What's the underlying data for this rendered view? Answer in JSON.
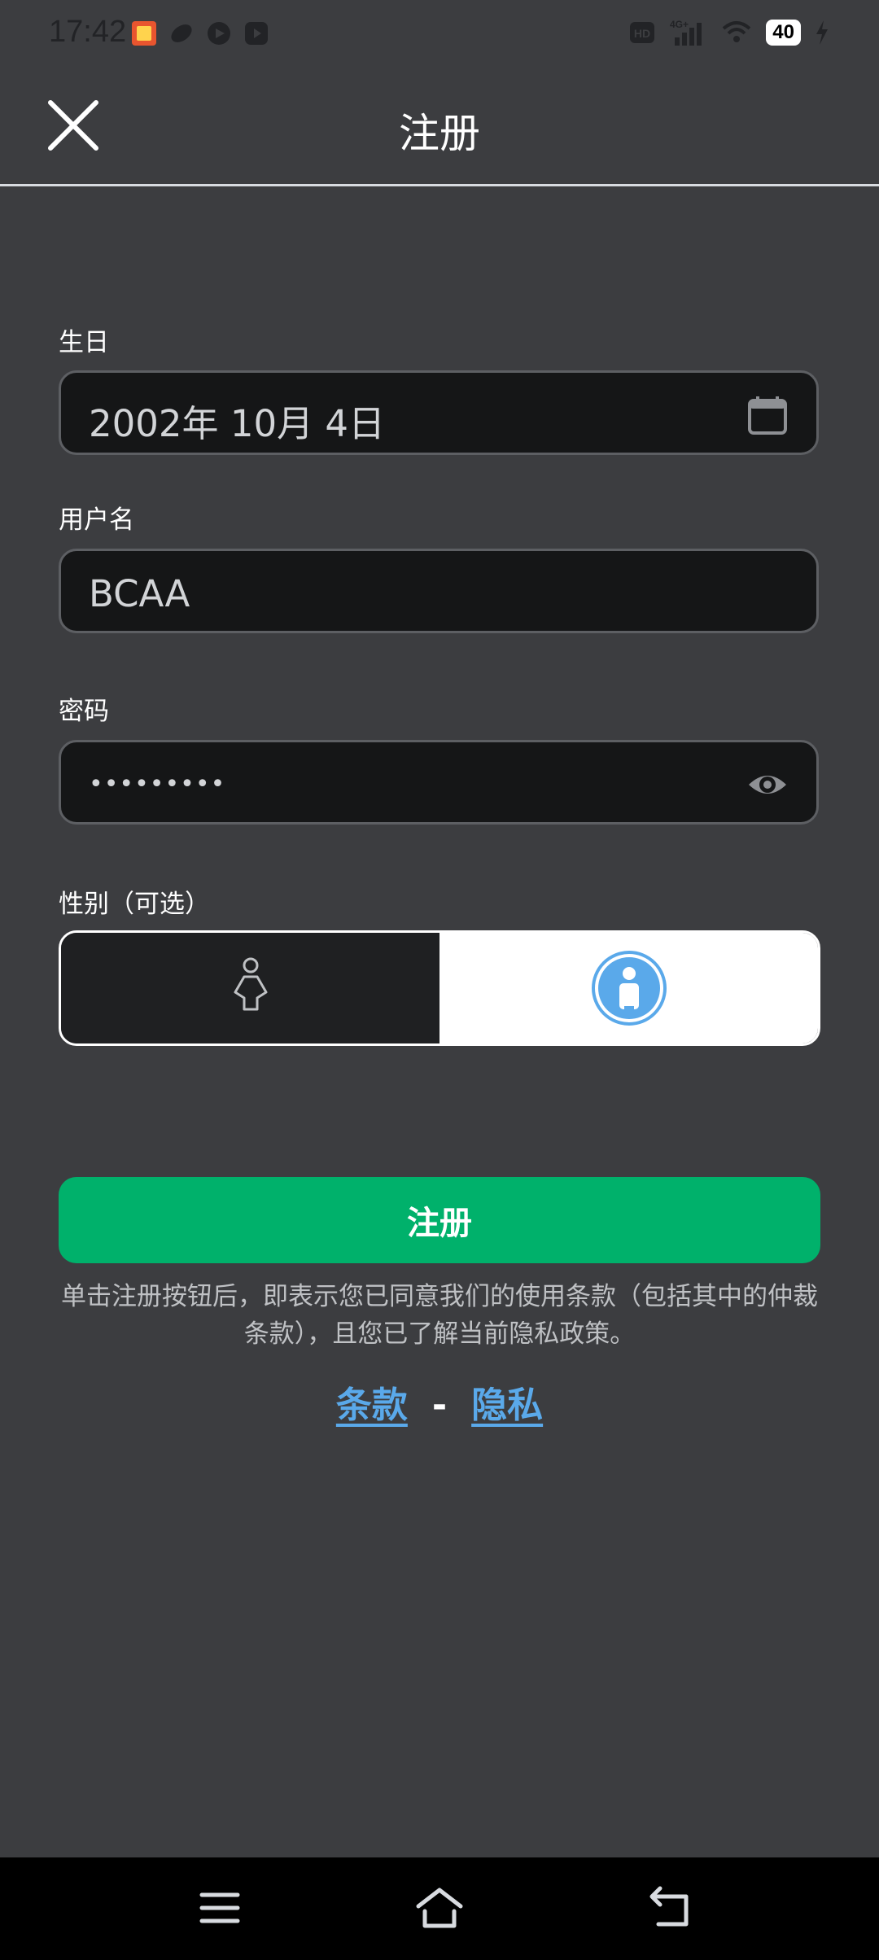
{
  "status_bar": {
    "time": "17:42",
    "network": "4G+",
    "battery": "40"
  },
  "header": {
    "title": "注册"
  },
  "form": {
    "birthday": {
      "label": "生日",
      "value": "2002年 10月 4日"
    },
    "username": {
      "label": "用户名",
      "value": "BCAA"
    },
    "password": {
      "label": "密码",
      "value": "•••••••••"
    },
    "gender": {
      "label": "性别（可选）",
      "selected": "male"
    }
  },
  "register_button": "注册",
  "legal": {
    "text": "单击注册按钮后，即表示您已同意我们的使用条款（包括其中的仲裁条款），且您已了解当前隐私政策。",
    "terms_link": "条款",
    "separator": "-",
    "privacy_link": "隐私"
  },
  "colors": {
    "background": "#3c3d40",
    "input_bg": "#151617",
    "accent_green": "#00b16b",
    "link_blue": "#5aa9ea",
    "gender_icon_blue": "#5aa9ea"
  },
  "icons": {
    "close": "close-icon",
    "calendar": "calendar-icon",
    "eye": "eye-icon",
    "female": "female-icon",
    "male": "male-icon",
    "nav_menu": "menu-icon",
    "nav_home": "home-icon",
    "nav_back": "back-icon"
  }
}
